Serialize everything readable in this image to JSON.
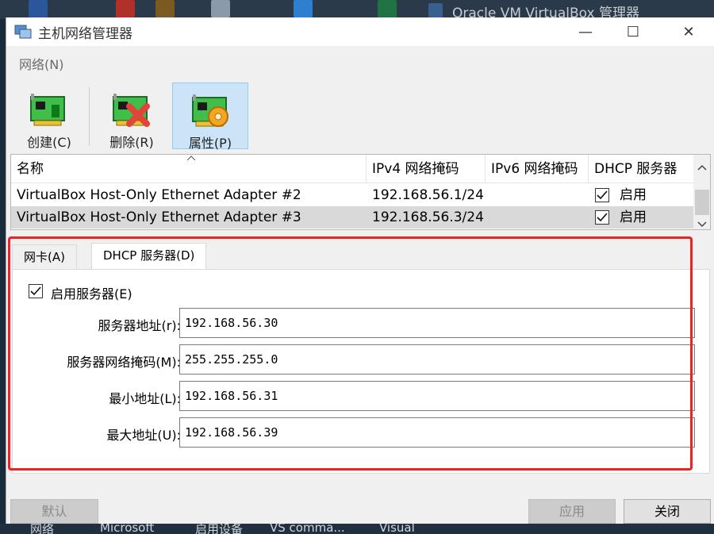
{
  "taskbar": {
    "background_window_title": "Oracle VM VirtualBox 管理器",
    "bottom_items": [
      "网络",
      "Microsoft",
      "启用设备",
      "VS comma...",
      "Visual"
    ]
  },
  "window": {
    "title": "主机网络管理器",
    "controls": {
      "minimize": "—",
      "maximize": "☐",
      "close": "✕"
    }
  },
  "menu": {
    "network": "网络(N)"
  },
  "toolbar": {
    "create": "创建(C)",
    "delete": "删除(R)",
    "properties": "属性(P)"
  },
  "adapters": {
    "columns": [
      "名称",
      "IPv4 网络掩码",
      "IPv6 网络掩码",
      "DHCP 服务器"
    ],
    "rows": [
      {
        "name": "VirtualBox Host-Only Ethernet Adapter #2",
        "ipv4": "192.168.56.1/24",
        "ipv6": "",
        "dhcp": "启用",
        "dhcp_checked": true
      },
      {
        "name": "VirtualBox Host-Only Ethernet Adapter #3",
        "ipv4": "192.168.56.3/24",
        "ipv6": "",
        "dhcp": "启用",
        "dhcp_checked": true
      }
    ]
  },
  "tabs": {
    "adapter": "网卡(A)",
    "dhcp": "DHCP 服务器(D)"
  },
  "dhcp": {
    "enable_label": "启用服务器(E)",
    "enabled": true,
    "fields": [
      {
        "label": "服务器地址(r):",
        "value": "192.168.56.30"
      },
      {
        "label": "服务器网络掩码(M):",
        "value": "255.255.255.0"
      },
      {
        "label": "最小地址(L):",
        "value": "192.168.56.31"
      },
      {
        "label": "最大地址(U):",
        "value": "192.168.56.39"
      }
    ]
  },
  "buttons": {
    "reset": "默认",
    "apply": "应用",
    "close": "关闭"
  },
  "colors": {
    "highlight": "#ee2222",
    "selected_tool": "#cce4f7",
    "selected_row": "#d9d9d9"
  }
}
